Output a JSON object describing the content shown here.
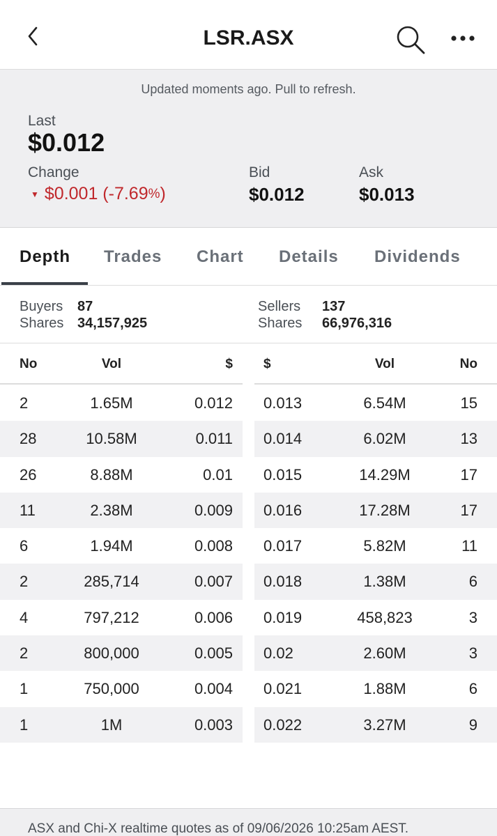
{
  "header": {
    "title": "LSR.ASX",
    "icons": {
      "back": "chevron-left-icon",
      "search": "search-icon",
      "more": "more-horizontal-icon"
    }
  },
  "quote": {
    "updated_text": "Updated moments ago. Pull to refresh.",
    "last_label": "Last",
    "last_value": "$0.012",
    "change_label": "Change",
    "change_value": "$0.001 (-7.69",
    "change_pct_sign": "%",
    "change_suffix": ")",
    "bid_label": "Bid",
    "bid_value": "$0.012",
    "ask_label": "Ask",
    "ask_value": "$0.013",
    "colors": {
      "negative": "#c0282c"
    }
  },
  "tabs": [
    {
      "label": "Depth"
    },
    {
      "label": "Trades"
    },
    {
      "label": "Chart"
    },
    {
      "label": "Details"
    },
    {
      "label": "Dividends"
    }
  ],
  "summary": {
    "buyers_label": "Buyers",
    "buyers_value": "87",
    "buyers_shares_label": "Shares",
    "buyers_shares_value": "34,157,925",
    "sellers_label": "Sellers",
    "sellers_value": "137",
    "sellers_shares_label": "Shares",
    "sellers_shares_value": "66,976,316"
  },
  "depth": {
    "columns_buy": {
      "no": "No",
      "vol": "Vol",
      "price": "$"
    },
    "columns_sell": {
      "price": "$",
      "vol": "Vol",
      "no": "No"
    },
    "buy": [
      {
        "no": "2",
        "vol": "1.65M",
        "price": "0.012"
      },
      {
        "no": "28",
        "vol": "10.58M",
        "price": "0.011"
      },
      {
        "no": "26",
        "vol": "8.88M",
        "price": "0.01"
      },
      {
        "no": "11",
        "vol": "2.38M",
        "price": "0.009"
      },
      {
        "no": "6",
        "vol": "1.94M",
        "price": "0.008"
      },
      {
        "no": "2",
        "vol": "285,714",
        "price": "0.007"
      },
      {
        "no": "4",
        "vol": "797,212",
        "price": "0.006"
      },
      {
        "no": "2",
        "vol": "800,000",
        "price": "0.005"
      },
      {
        "no": "1",
        "vol": "750,000",
        "price": "0.004"
      },
      {
        "no": "1",
        "vol": "1M",
        "price": "0.003"
      }
    ],
    "sell": [
      {
        "price": "0.013",
        "vol": "6.54M",
        "no": "15"
      },
      {
        "price": "0.014",
        "vol": "6.02M",
        "no": "13"
      },
      {
        "price": "0.015",
        "vol": "14.29M",
        "no": "17"
      },
      {
        "price": "0.016",
        "vol": "17.28M",
        "no": "17"
      },
      {
        "price": "0.017",
        "vol": "5.82M",
        "no": "11"
      },
      {
        "price": "0.018",
        "vol": "1.38M",
        "no": "6"
      },
      {
        "price": "0.019",
        "vol": "458,823",
        "no": "3"
      },
      {
        "price": "0.02",
        "vol": "2.60M",
        "no": "3"
      },
      {
        "price": "0.021",
        "vol": "1.88M",
        "no": "6"
      },
      {
        "price": "0.022",
        "vol": "3.27M",
        "no": "9"
      }
    ]
  },
  "footer": {
    "text": "ASX and Chi-X realtime quotes as of 09/06/2026 10:25am AEST."
  }
}
